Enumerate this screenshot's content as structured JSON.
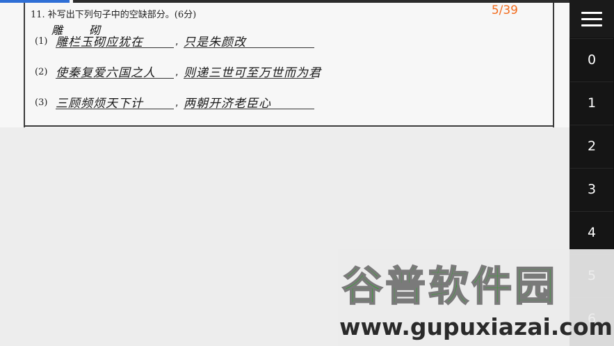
{
  "sheet": {
    "question": "11. 补写出下列句子中的空缺部分。(6分)",
    "rows": [
      {
        "num": "(1)",
        "answer_a": "雕栏玉砌应犹在",
        "answer_b": "只是朱颜改"
      },
      {
        "num": "(2)",
        "answer_a": "使秦复爱六国之人",
        "answer_b": "则递三世可至万世而为君"
      },
      {
        "num": "(3)",
        "answer_a": "三顾频烦天下计",
        "answer_b": "两朝开济老臣心"
      }
    ],
    "annotation_1": "雕",
    "annotation_2": "砌",
    "progress": 0.12
  },
  "page_indicator": "5/39",
  "side_nav": {
    "menu_icon": "hamburger-icon",
    "pages": [
      "0",
      "1",
      "2",
      "3",
      "4",
      "5",
      "6"
    ]
  },
  "watermark": {
    "title": "谷普软件园",
    "url": "www.gupuxiazai.com"
  },
  "colors": {
    "accent": "#f26a1b",
    "progress": "#2f6fd6",
    "watermark_green": "#2fa52a"
  }
}
